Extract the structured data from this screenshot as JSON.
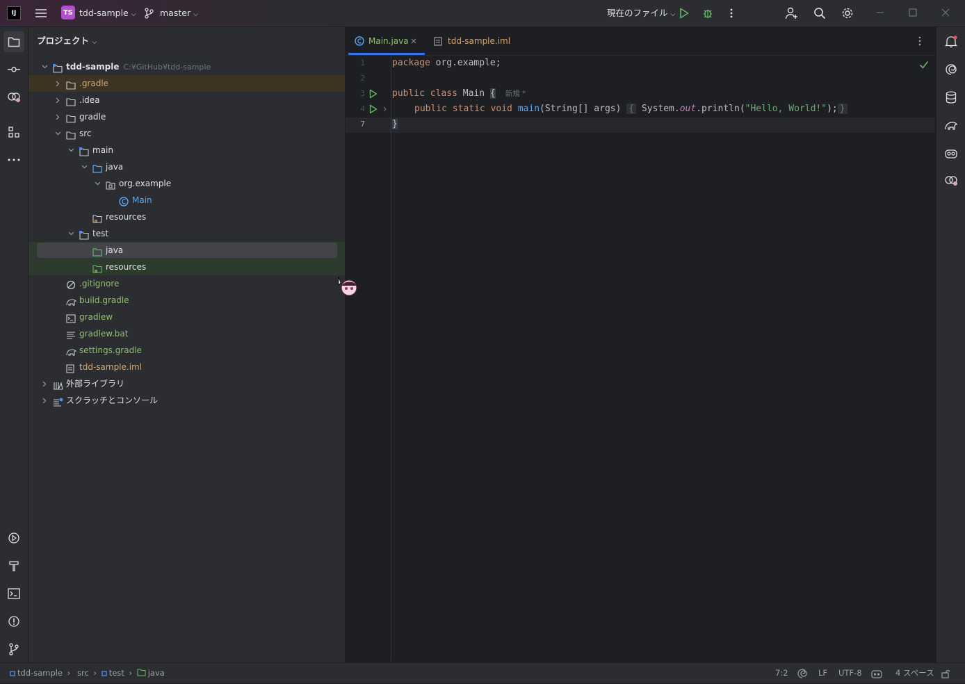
{
  "titlebar": {
    "app_logo": "IJ",
    "menu_icon": "hamburger-icon",
    "project_badge": "TS",
    "project_name": "tdd-sample",
    "branch": "master",
    "run_config": "現在のファイル"
  },
  "project_panel": {
    "title": "プロジェクト",
    "tree": [
      {
        "label": "tdd-sample",
        "path": "C:¥GitHub¥tdd-sample",
        "color": "#dfe1e5",
        "bold": true
      },
      {
        "label": ".gradle",
        "color": "#d5a86b"
      },
      {
        "label": ".idea",
        "color": "#dfe1e5"
      },
      {
        "label": "gradle",
        "color": "#dfe1e5"
      },
      {
        "label": "src",
        "color": "#dfe1e5"
      },
      {
        "label": "main",
        "color": "#dfe1e5"
      },
      {
        "label": "java",
        "color": "#dfe1e5"
      },
      {
        "label": "org.example",
        "color": "#dfe1e5"
      },
      {
        "label": "Main",
        "color": "#56a8f5"
      },
      {
        "label": "resources",
        "color": "#dfe1e5"
      },
      {
        "label": "test",
        "color": "#dfe1e5"
      },
      {
        "label": "java",
        "color": "#dfe1e5"
      },
      {
        "label": "resources",
        "color": "#dfe1e5"
      },
      {
        "label": ".gitignore",
        "color": "#8fc26a"
      },
      {
        "label": "build.gradle",
        "color": "#8fc26a"
      },
      {
        "label": "gradlew",
        "color": "#8fc26a"
      },
      {
        "label": "gradlew.bat",
        "color": "#8fc26a"
      },
      {
        "label": "settings.gradle",
        "color": "#8fc26a"
      },
      {
        "label": "tdd-sample.iml",
        "color": "#d5a86b"
      },
      {
        "label": "外部ライブラリ",
        "color": "#dfe1e5"
      },
      {
        "label": "スクラッチとコンソール",
        "color": "#dfe1e5"
      }
    ]
  },
  "tabs": [
    {
      "label": "Main.java",
      "active": true
    },
    {
      "label": "tdd-sample.iml",
      "active": false
    }
  ],
  "editor": {
    "line_numbers": [
      "1",
      "2",
      "3",
      "4",
      "7"
    ],
    "inlay_hint": "新規 *",
    "code": {
      "l1_kw": "package",
      "l1_rest": " org.example;",
      "l3_kw": "public class",
      "l3_rest": " Main ",
      "l3_brace": "{",
      "l4_kw": "public static void",
      "l4_fn": "main",
      "l4_args": "(String[] args)",
      "l4_open": "{",
      "l4_sys": " System.",
      "l4_out": "out",
      "l4_call": ".println(",
      "l4_str": "\"Hello, World!\"",
      "l4_end": ");",
      "l4_close": "}",
      "l7": "}"
    }
  },
  "statusbar": {
    "breadcrumb": [
      "tdd-sample",
      "src",
      "test",
      "java"
    ],
    "position": "7:2",
    "line_sep": "LF",
    "encoding": "UTF-8",
    "indent": "4 スペース"
  },
  "colors": {
    "accent": "#3574f0",
    "green": "#5fb865",
    "vcs_modified": "#8fc26a",
    "ignored": "#d5a86b"
  }
}
